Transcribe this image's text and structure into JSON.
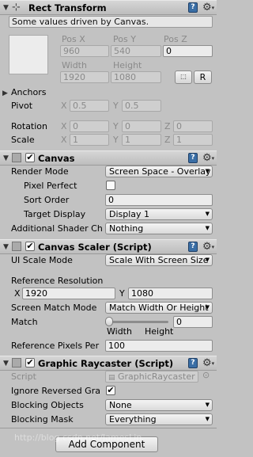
{
  "rect_transform": {
    "title": "Rect Transform",
    "note": "Some values driven by Canvas.",
    "labels": {
      "pos_x": "Pos X",
      "pos_y": "Pos Y",
      "pos_z": "Pos Z",
      "width": "Width",
      "height": "Height"
    },
    "pos_x": "960",
    "pos_y": "540",
    "pos_z": "0",
    "width": "1920",
    "height": "1080",
    "raw_button": "R",
    "anchors_label": "Anchors",
    "pivot_label": "Pivot",
    "pivot": {
      "x_label": "X",
      "x": "0.5",
      "y_label": "Y",
      "y": "0.5"
    },
    "rotation_label": "Rotation",
    "rotation": {
      "x_label": "X",
      "x": "0",
      "y_label": "Y",
      "y": "0",
      "z_label": "Z",
      "z": "0"
    },
    "scale_label": "Scale",
    "scale": {
      "x_label": "X",
      "x": "1",
      "y_label": "Y",
      "y": "1",
      "z_label": "Z",
      "z": "1"
    }
  },
  "canvas": {
    "title": "Canvas",
    "render_mode_label": "Render Mode",
    "render_mode": "Screen Space - Overlay",
    "pixel_perfect_label": "Pixel Perfect",
    "sort_order_label": "Sort Order",
    "sort_order": "0",
    "target_display_label": "Target Display",
    "target_display": "Display 1",
    "additional_shader_label": "Additional Shader Ch",
    "additional_shader": "Nothing"
  },
  "canvas_scaler": {
    "title": "Canvas Scaler (Script)",
    "ui_scale_mode_label": "UI Scale Mode",
    "ui_scale_mode": "Scale With Screen Size",
    "reference_resolution_label": "Reference Resolution",
    "ref_x_label": "X",
    "ref_x": "1920",
    "ref_y_label": "Y",
    "ref_y": "1080",
    "screen_match_mode_label": "Screen Match Mode",
    "screen_match_mode": "Match Width Or Height",
    "match_label": "Match",
    "match_value": "0",
    "match_fraction": 0,
    "slider_left_label": "Width",
    "slider_right_label": "Height",
    "reference_pixels_label": "Reference Pixels Per",
    "reference_pixels": "100"
  },
  "graphic_raycaster": {
    "title": "Graphic Raycaster (Script)",
    "script_label": "Script",
    "script_value": "GraphicRaycaster",
    "ignore_reversed_label": "Ignore Reversed Gra",
    "blocking_objects_label": "Blocking Objects",
    "blocking_objects": "None",
    "blocking_mask_label": "Blocking Mask",
    "blocking_mask": "Everything"
  },
  "add_component_label": "Add Component",
  "watermark": "http://blog.csdn.net/JamesLin"
}
